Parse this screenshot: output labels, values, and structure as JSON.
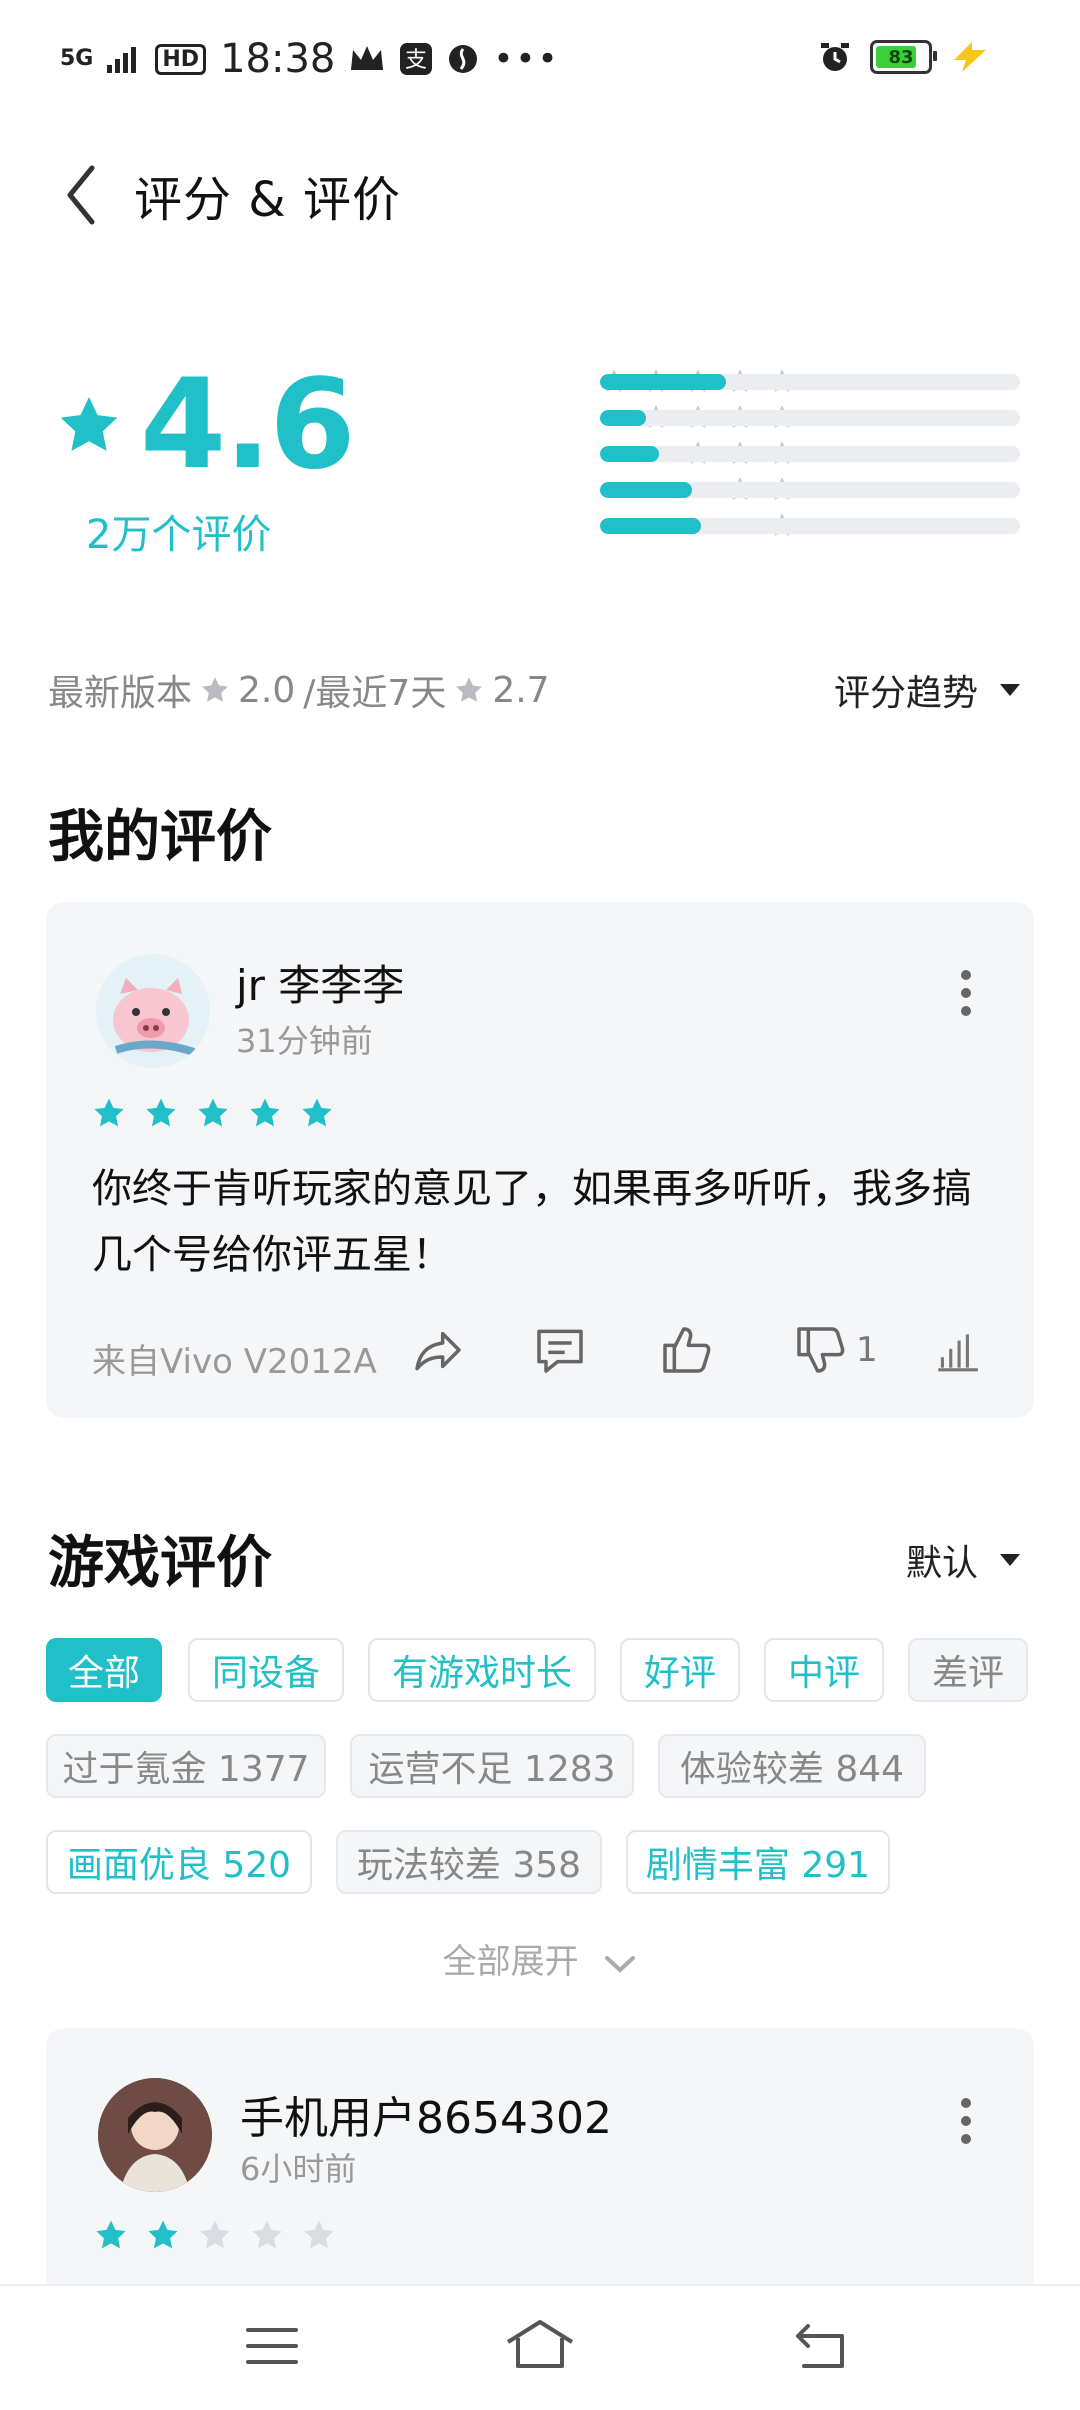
{
  "status_bar": {
    "network": "5G",
    "hd": "HD",
    "time": "18:38",
    "battery": "83",
    "battery_level": 0.83
  },
  "header": {
    "title": "评分 & 评价"
  },
  "summary": {
    "score": "4.6",
    "count": "2万个评价",
    "distribution": [
      {
        "stars": 5,
        "fraction": 0.3
      },
      {
        "stars": 4,
        "fraction": 0.11
      },
      {
        "stars": 3,
        "fraction": 0.14
      },
      {
        "stars": 2,
        "fraction": 0.22
      },
      {
        "stars": 1,
        "fraction": 0.24
      }
    ],
    "version_label": "最新版本",
    "version_score": "2.0",
    "recent_label": "/最近7天",
    "recent_score": "2.7",
    "trend_label": "评分趋势"
  },
  "my_review": {
    "section_title": "我的评价",
    "user_name": "jr  李李李",
    "time": "31分钟前",
    "rating": 5,
    "text": "你终于肯听玩家的意见了，如果再多听听，我多搞几个号给你评五星！",
    "device": "来自Vivo V2012A",
    "dislike_count": "1"
  },
  "game_reviews": {
    "section_title": "游戏评价",
    "sort_label": "默认",
    "tags": [
      {
        "label": "全部",
        "style": "active"
      },
      {
        "label": "同设备",
        "style": "teal"
      },
      {
        "label": "有游戏时长",
        "style": "teal"
      },
      {
        "label": "好评",
        "style": "teal"
      },
      {
        "label": "中评",
        "style": "teal"
      },
      {
        "label": "差评",
        "style": "gray"
      },
      {
        "label": "过于氪金 1377",
        "style": "gray"
      },
      {
        "label": "运营不足 1283",
        "style": "gray"
      },
      {
        "label": "体验较差 844",
        "style": "gray"
      },
      {
        "label": "画面优良 520",
        "style": "teal"
      },
      {
        "label": "玩法较差 358",
        "style": "gray"
      },
      {
        "label": "剧情丰富 291",
        "style": "teal"
      }
    ],
    "expand_label": "全部展开",
    "first_review": {
      "user_name": "手机用户8654302",
      "time": "6小时前",
      "rating": 2
    }
  },
  "colors": {
    "accent": "#21c0c9",
    "star_gray": "#cfd2d6"
  }
}
